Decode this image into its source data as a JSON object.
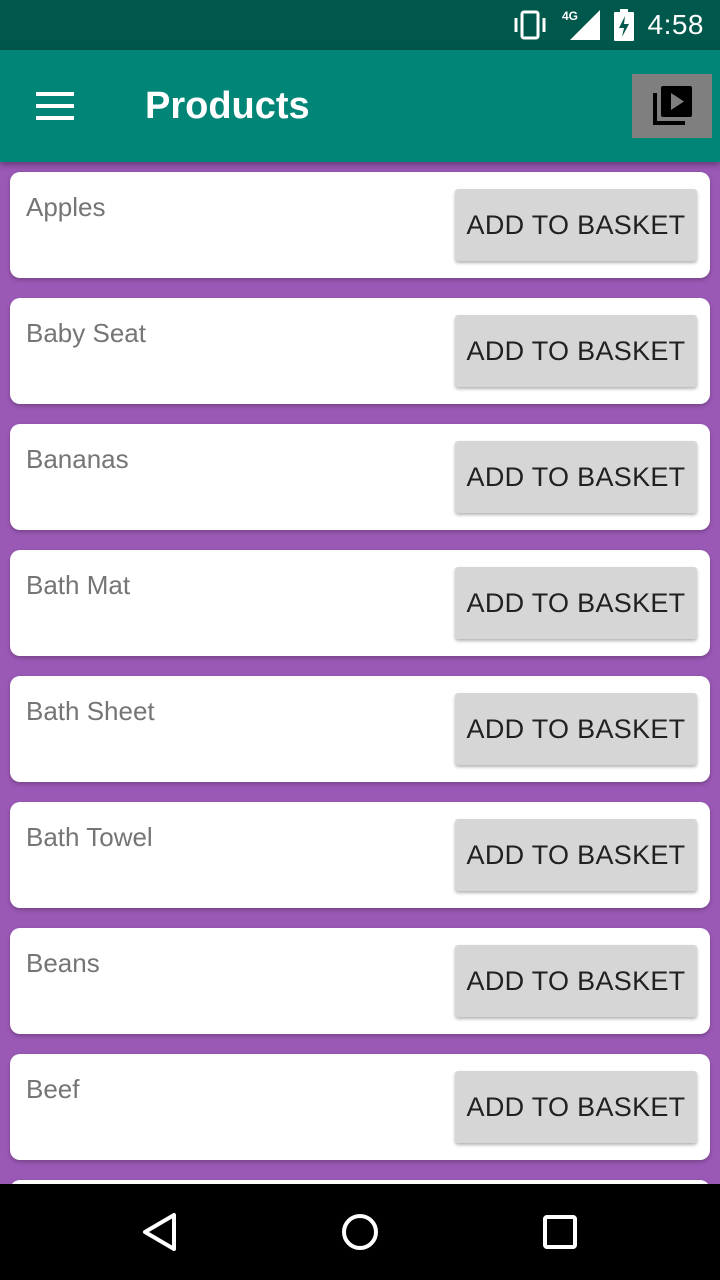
{
  "status_bar": {
    "network": "4G",
    "time": "4:58",
    "icons": [
      "vibrate-icon",
      "signal-icon",
      "battery-charging-icon"
    ]
  },
  "app_bar": {
    "title": "Products",
    "menu_icon": "hamburger-menu-icon",
    "action_icon": "video-library-icon"
  },
  "products": [
    {
      "name": "Apples",
      "button": "ADD TO BASKET"
    },
    {
      "name": "Baby Seat",
      "button": "ADD TO BASKET"
    },
    {
      "name": "Bananas",
      "button": "ADD TO BASKET"
    },
    {
      "name": "Bath Mat",
      "button": "ADD TO BASKET"
    },
    {
      "name": "Bath Sheet",
      "button": "ADD TO BASKET"
    },
    {
      "name": "Bath Towel",
      "button": "ADD TO BASKET"
    },
    {
      "name": "Beans",
      "button": "ADD TO BASKET"
    },
    {
      "name": "Beef",
      "button": "ADD TO BASKET"
    }
  ],
  "nav_bar": {
    "icons": [
      "back-icon",
      "home-icon",
      "recents-icon"
    ]
  },
  "colors": {
    "status_bar": "#00574b",
    "app_bar": "#008577",
    "list_background": "#9b59b6",
    "button": "#d6d6d6"
  }
}
